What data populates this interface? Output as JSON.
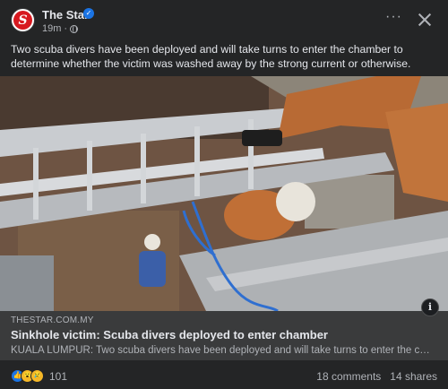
{
  "header": {
    "page_name": "The Star",
    "avatar_letter": "S",
    "time": "19m",
    "separator": "·",
    "icons": [
      "verified-badge-icon",
      "globe-icon",
      "more-icon",
      "close-icon"
    ]
  },
  "post": {
    "text": "Two scuba divers have been deployed and will take turns to enter the chamber to determine whether the victim was washed away by the strong current or otherwise."
  },
  "link": {
    "domain": "THESTAR.COM.MY",
    "title": "Sinkhole victim: Scuba divers deployed to enter chamber",
    "description": "KUALA LUMPUR: Two scuba divers have been deployed and will take turns to enter the chamb...",
    "info_label": "i"
  },
  "footer": {
    "reaction_count": "101",
    "comments": "18 comments",
    "shares": "14 shares",
    "reactions": [
      "like-icon",
      "wow-icon",
      "sad-icon"
    ]
  },
  "colors": {
    "background": "#242526",
    "preview_bg": "#3a3b3c",
    "text_primary": "#e4e6eb",
    "text_secondary": "#b0b3b8",
    "brand_red": "#d71920",
    "facebook_blue": "#1b74e4"
  }
}
